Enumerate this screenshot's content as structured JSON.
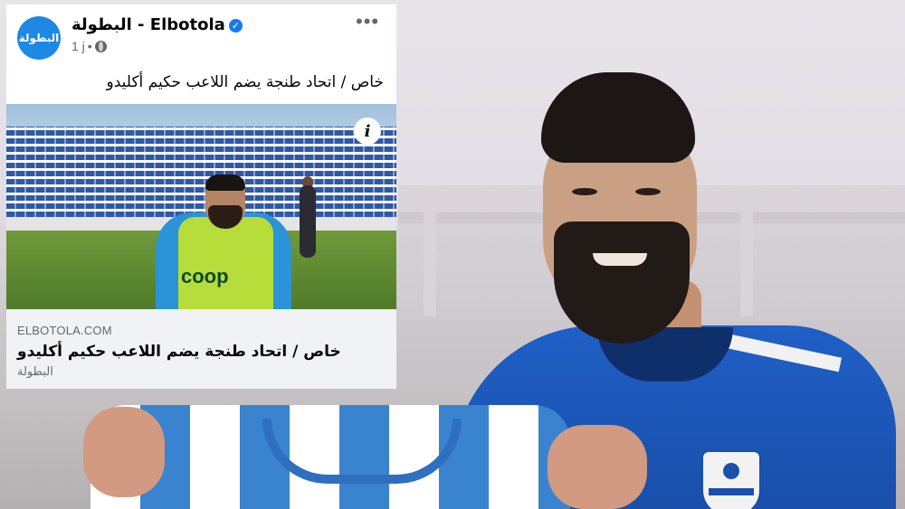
{
  "post": {
    "avatar_text": "البطولة",
    "page_name": "البطولة - Elbotola",
    "verified_mark": "✓",
    "time": "1 j",
    "separator": "•",
    "text": "خاص / اتحاد طنجة يضم اللاعب حكيم أكليدو",
    "more_label": "•••"
  },
  "link_preview": {
    "info_label": "i",
    "bib_text": "coop",
    "domain": "ELBOTOLA.COM",
    "title": "خاص / اتحاد طنجة يضم اللاعب حكيم أكليدو",
    "source": "البطولة"
  },
  "colors": {
    "brand_blue": "#1e88e5",
    "verified_blue": "#1877f2",
    "jersey_blue": "#1f5fc6",
    "secondary_text": "#65676b"
  }
}
